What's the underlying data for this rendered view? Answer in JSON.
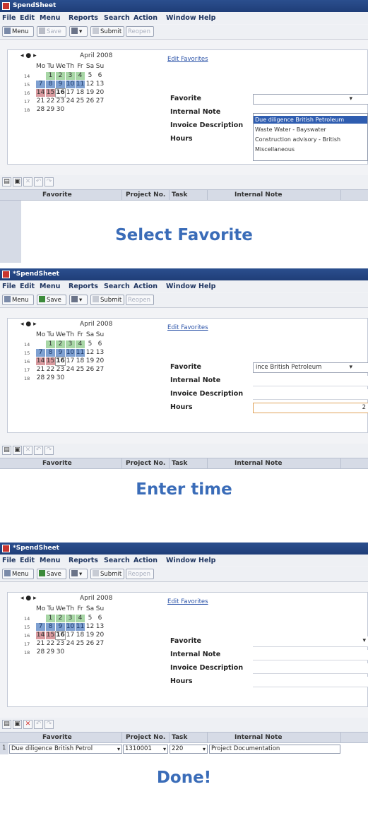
{
  "app": {
    "title_1": "SpendSheet",
    "title_2": "*SpendSheet",
    "title_3": "*SpendSheet"
  },
  "menu": [
    "File",
    "Edit",
    "Menu",
    "Reports",
    "Search",
    "Action",
    "Window",
    "Help"
  ],
  "toolbar": {
    "menu": "Menu",
    "save": "Save",
    "submit": "Submit",
    "reopen": "Reopen"
  },
  "calendar": {
    "month": "April 2008",
    "days": [
      "Mo",
      "Tu",
      "We",
      "Th",
      "Fr",
      "Sa",
      "Su"
    ],
    "weeks": [
      {
        "num": "14",
        "days": [
          "",
          "1",
          "2",
          "3",
          "4",
          "5",
          "6"
        ]
      },
      {
        "num": "15",
        "days": [
          "7",
          "8",
          "9",
          "10",
          "11",
          "12",
          "13"
        ]
      },
      {
        "num": "16",
        "days": [
          "14",
          "15",
          "16",
          "17",
          "18",
          "19",
          "20"
        ]
      },
      {
        "num": "17",
        "days": [
          "21",
          "22",
          "23",
          "24",
          "25",
          "26",
          "27"
        ]
      },
      {
        "num": "18",
        "days": [
          "28",
          "29",
          "30",
          "",
          "",
          "",
          ""
        ]
      }
    ]
  },
  "form": {
    "edit_favorites": "Edit Favorites",
    "favorite_label": "Favorite",
    "internal_note_label": "Internal Note",
    "invoice_description_label": "Invoice Description",
    "hours_label": "Hours",
    "favorite_value_2": "ince British Petroleum",
    "hours_value_2": "2"
  },
  "dropdown": {
    "options": [
      "Due diligence British Petroleum",
      "Waste Water - Bayswater",
      "Construction advisory - British",
      "Miscellaneous"
    ]
  },
  "grid": {
    "headers": [
      "Favorite",
      "Project No.",
      "Task",
      "Internal Note"
    ],
    "row_1": {
      "num": "1",
      "favorite": "Due diligence British Petrol",
      "project": "1310001",
      "task": "220",
      "note": "Project Documentation"
    }
  },
  "captions": {
    "step1": "Select Favorite",
    "step2": "Enter time",
    "step3": "Done!"
  }
}
